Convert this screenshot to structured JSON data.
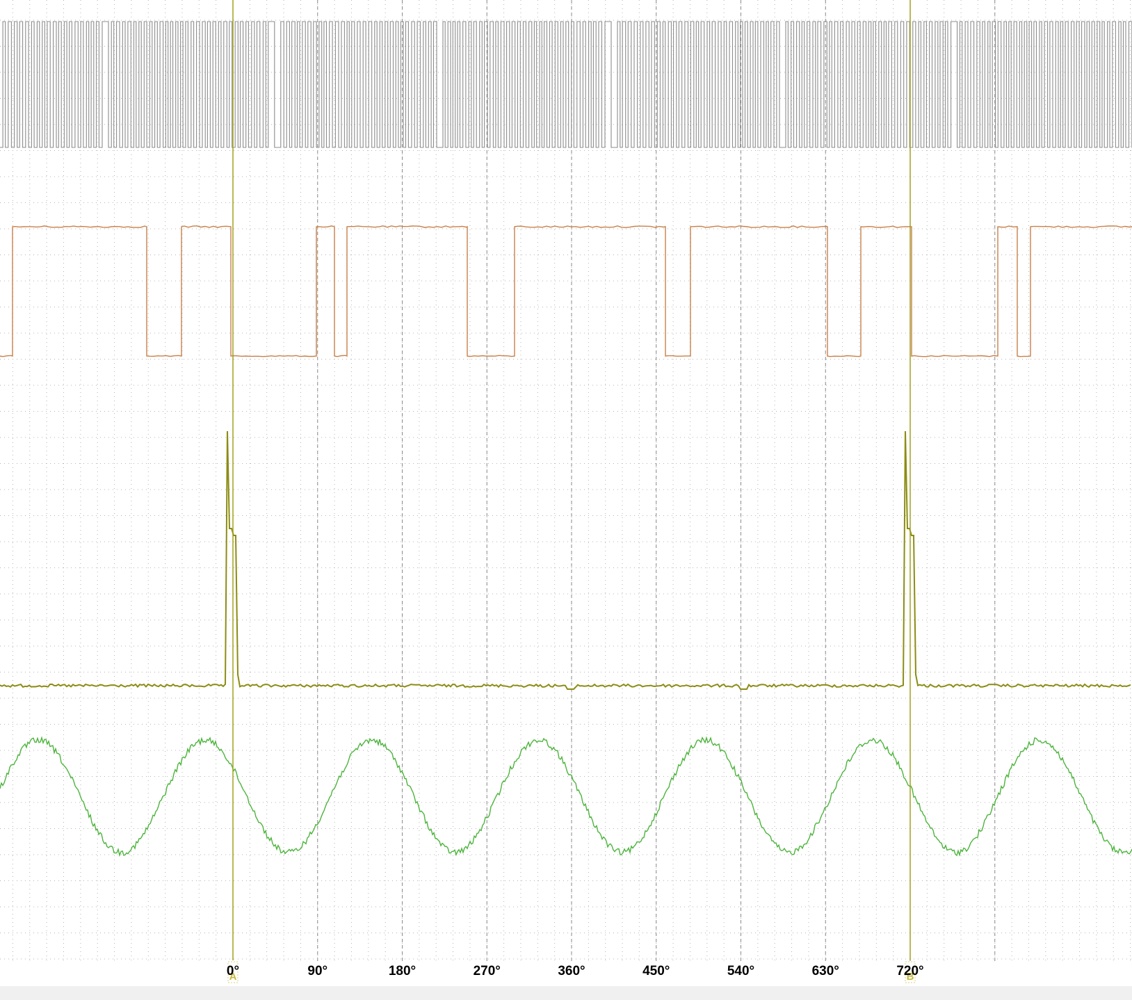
{
  "scope": {
    "colors": {
      "background": "#ffffff",
      "grid": "#b4b4b4",
      "channel_a": "#8c8c8c",
      "channel_b": "#c8804a",
      "channel_c": "#8c8c14",
      "channel_d": "#4cb43c",
      "ruler": "#a0a020"
    },
    "phase_axis": {
      "labels": [
        "0°",
        "90°",
        "180°",
        "270°",
        "360°",
        "450°",
        "540°",
        "630°",
        "720°"
      ]
    },
    "rulers": [
      {
        "id": "A",
        "phase_deg": 0
      },
      {
        "id": "B",
        "phase_deg": 720
      }
    ]
  }
}
